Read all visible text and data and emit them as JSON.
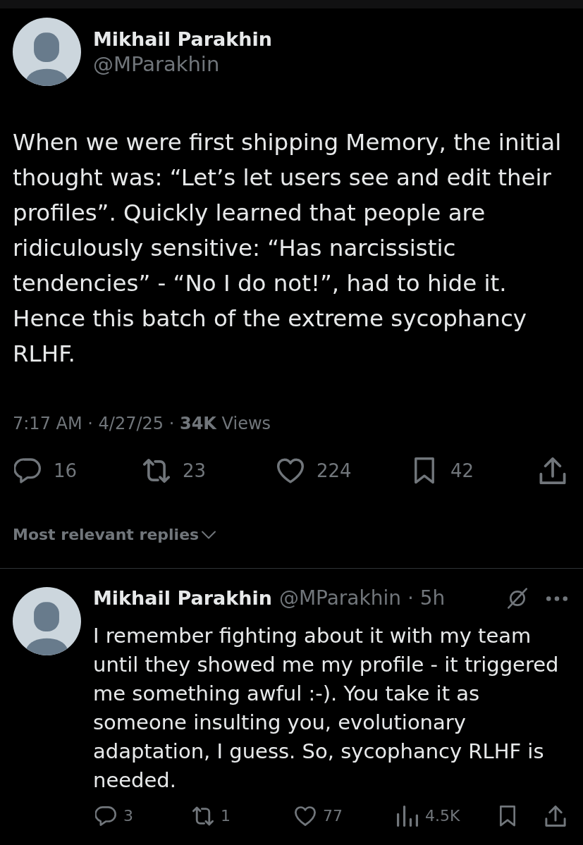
{
  "post": {
    "author": {
      "name": "Mikhail Parakhin",
      "handle": "@MParakhin"
    },
    "text": "When we were first shipping Memory, the initial thought was: “Let’s let users see and edit their profiles”. Quickly learned that people are ridiculously sensitive: “Has narcissistic tendencies” - “No I do not!”, had to hide it. Hence this batch of the extreme sycophancy RLHF.",
    "meta": "7:17 AM · 4/27/25 · **34K** Views",
    "actions": [
      {
        "kind": "reply",
        "count": "16"
      },
      {
        "kind": "repost",
        "count": "23"
      },
      {
        "kind": "like",
        "count": "224"
      },
      {
        "kind": "bookmark",
        "count": "42"
      },
      {
        "kind": "share"
      }
    ]
  },
  "replies_sort": {
    "label": "Most relevant replies"
  },
  "replies": [
    {
      "author": {
        "name": "Mikhail Parakhin",
        "byline": "@MParakhin · 5h"
      },
      "text": "I remember fighting about it with my team until they showed me my profile - it triggered me something awful :-). You take it as someone insulting you, evolutionary adaptation, I guess. So, sycophancy RLHF is needed.",
      "actions": [
        {
          "kind": "reply",
          "count": "3"
        },
        {
          "kind": "repost",
          "count": "1"
        },
        {
          "kind": "like",
          "count": "77"
        },
        {
          "kind": "views",
          "count": "4.5K"
        },
        {
          "kind": "bookmark"
        },
        {
          "kind": "share"
        }
      ]
    }
  ]
}
